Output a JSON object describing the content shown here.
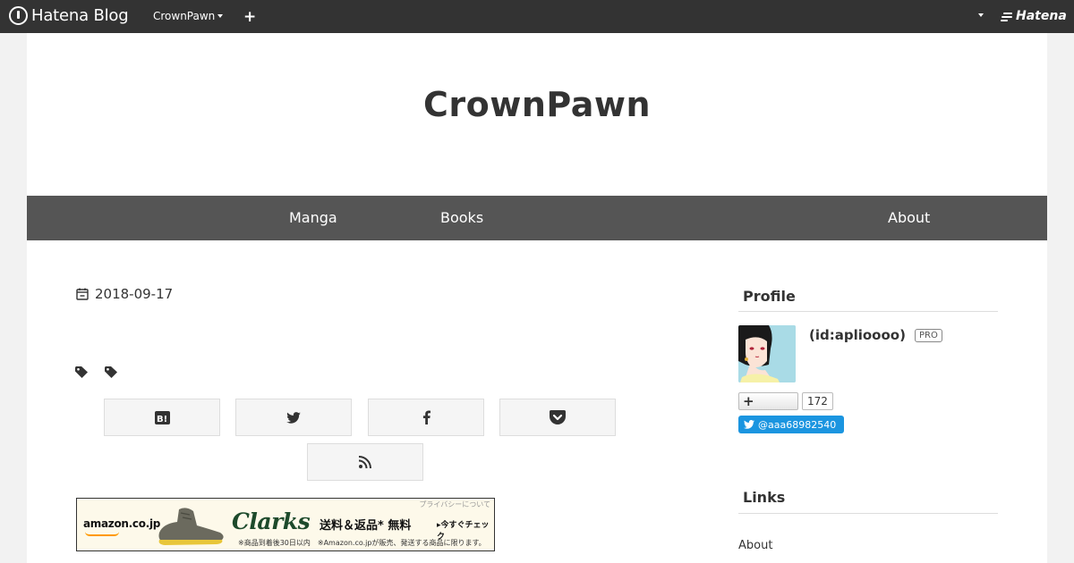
{
  "globalbar": {
    "logo_text": "Hatena Blog",
    "blog_name": "CrownPawn",
    "add_label": "+",
    "brand_text": "Hatena"
  },
  "blog": {
    "title": "CrownPawn"
  },
  "nav": {
    "items": [
      {
        "label": "Manga"
      },
      {
        "label": "Books"
      },
      {
        "label": "About"
      }
    ]
  },
  "entry": {
    "date": "2018-09-17",
    "share_buttons": [
      {
        "icon": "hatena-bookmark-icon"
      },
      {
        "icon": "twitter-icon"
      },
      {
        "icon": "facebook-icon"
      },
      {
        "icon": "pocket-icon"
      },
      {
        "icon": "rss-icon"
      }
    ]
  },
  "ad": {
    "privacy": "プライバシーについて",
    "amazon": "amazon.co.jp",
    "brand": "Clarks",
    "offer": "送料＆返品* 無料",
    "cta": "▸今すぐチェック",
    "note": "※商品到着後30日以内　※Amazon.co.jpが販売、発送する商品に限ります。"
  },
  "sidebar": {
    "profile_heading": "Profile",
    "profile_id": "(id:aplioooo)",
    "pro_badge": "PRO",
    "follow_label": "+",
    "follow_count": "172",
    "twitter_handle": "@aaa68982540",
    "links_heading": "Links",
    "links": [
      {
        "label": "About"
      }
    ]
  },
  "colors": {
    "globalbar_bg": "#333333",
    "navbar_bg": "#555555",
    "twitter_blue": "#1b95e0"
  }
}
